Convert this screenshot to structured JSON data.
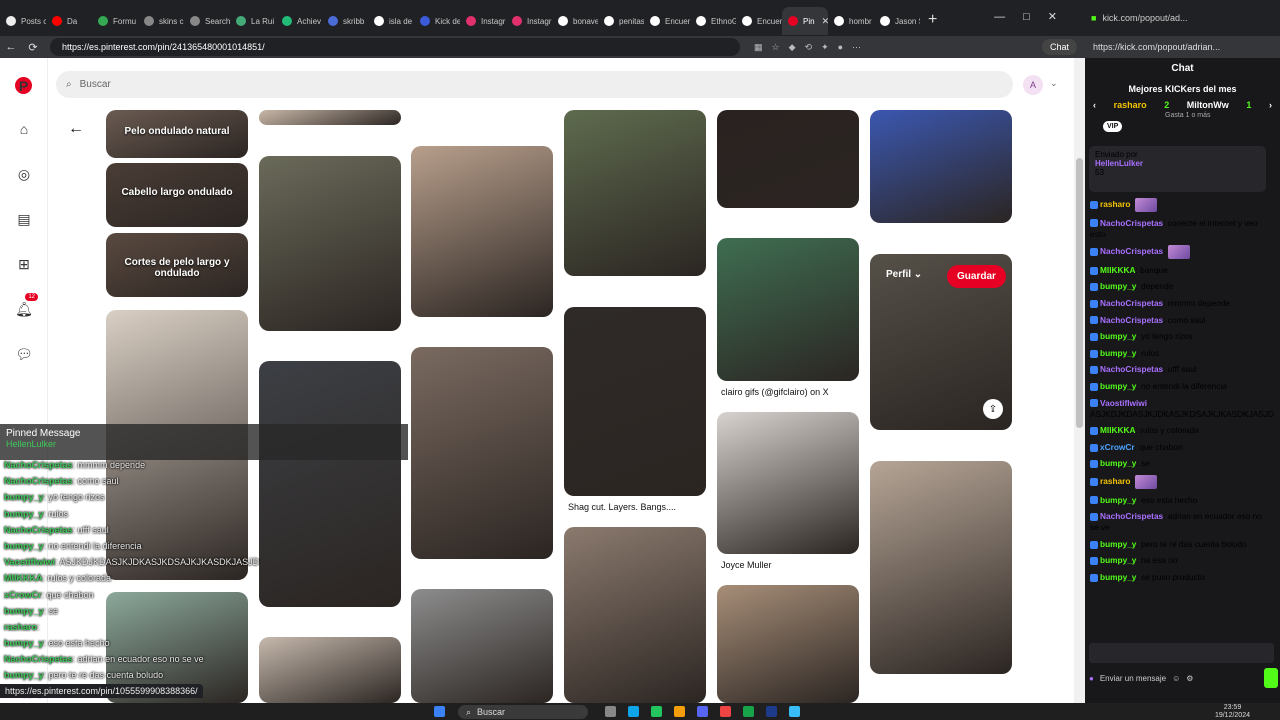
{
  "browser": {
    "tabs": [
      {
        "label": "Posts c",
        "color": "#eee"
      },
      {
        "label": "Da",
        "color": "#ff0000"
      },
      {
        "label": "Formu",
        "color": "#34a853"
      },
      {
        "label": "skins c",
        "color": "#888"
      },
      {
        "label": "Search",
        "color": "#888"
      },
      {
        "label": "La Rui",
        "color": "#4a7"
      },
      {
        "label": "Achiev",
        "color": "#2b7"
      },
      {
        "label": "skribb",
        "color": "#4b6bd8"
      },
      {
        "label": "isla de",
        "color": "#fff"
      },
      {
        "label": "Kick de",
        "color": "#3b5bdb"
      },
      {
        "label": "Instagr",
        "color": "#e1306c"
      },
      {
        "label": "Instagr",
        "color": "#e1306c"
      },
      {
        "label": "bonave",
        "color": "#fff"
      },
      {
        "label": "penitas",
        "color": "#fff"
      },
      {
        "label": "Encuen",
        "color": "#fff"
      },
      {
        "label": "EthnoG",
        "color": "#fff"
      },
      {
        "label": "Encuen",
        "color": "#fff"
      },
      {
        "label": "Pin",
        "color": "#e60023"
      },
      {
        "label": "hombr",
        "color": "#fff"
      },
      {
        "label": "Jason S",
        "color": "#fff"
      }
    ],
    "url": "https://es.pinterest.com/pin/241365480001014851/",
    "chat_button": "Chat",
    "status_url": "https://es.pinterest.com/pin/1055599908388366/"
  },
  "pinterest": {
    "search_placeholder": "Buscar",
    "avatar_letter": "A",
    "notification_count": "12",
    "boards": [
      "Pelo ondulado natural",
      "Cabello largo ondulado",
      "Cortes de pelo largo y ondulado"
    ],
    "captions": {
      "c1": "Shag cut. Layers. Bangs....",
      "c2": "clairo gifs (@gifclairo) on X",
      "c3": "Joyce Muller"
    },
    "perfil": "Perfil",
    "guardar": "Guardar"
  },
  "overlay": {
    "title": "Pinned Message",
    "pinned_user": "HellenLulker",
    "lines": [
      {
        "user": "NachoCrispetas",
        "text": "mmmm depende"
      },
      {
        "user": "NachoCrispetas",
        "text": "como saul"
      },
      {
        "user": "bumpy_y",
        "text": "yo tengo rizos"
      },
      {
        "user": "bumpy_y",
        "text": "rulos"
      },
      {
        "user": "NachoCrispetas",
        "text": "ufff saul"
      },
      {
        "user": "bumpy_y",
        "text": "no entendi la diferencia"
      },
      {
        "user": "Vaostiflwiwi",
        "text": "ASJKDJKDASJKJDKASJKDSAJKJKASDKJASJD"
      },
      {
        "user": "MIIKKKA",
        "text": "rulos y colorada"
      },
      {
        "user": "xCrowCr",
        "text": "que chabon"
      },
      {
        "user": "bumpy_y",
        "text": "se"
      },
      {
        "user": "rasharo",
        "text": ""
      },
      {
        "user": "bumpy_y",
        "text": "eso esta hecho"
      },
      {
        "user": "NachoCrispetas",
        "text": "adrian en ecuador eso no se ve"
      },
      {
        "user": "bumpy_y",
        "text": "pero te re das cuenta boludo"
      },
      {
        "user": "bumpy_y",
        "text": "na esa no"
      },
      {
        "user": "bumpy_y",
        "text": "se puso producto"
      }
    ]
  },
  "kick": {
    "tab_url_short": "kick.com/popout/ad...",
    "url": "https://kick.com/popout/adrian...",
    "chat_title": "Chat",
    "top_title": "Mejores KICKers del mes",
    "top1": "rasharo",
    "top1_count": "2",
    "top2": "MiltonWw",
    "top2_count": "1",
    "gasta": "Gasta 1",
    "o_mas": "o más",
    "vip": "VIP",
    "pinned_label": "Enviado por",
    "pinned_user": "HellenLulker",
    "pinned_text": "53",
    "messages": [
      {
        "user": "rasharo",
        "color": "#f3c400",
        "text": ""
      },
      {
        "user": "NachoCrispetas",
        "color": "#a970ff",
        "text": "conecte el internet y veo esto"
      },
      {
        "user": "NachoCrispetas",
        "color": "#a970ff",
        "text": ""
      },
      {
        "user": "MIIKKKA",
        "color": "#53fc18",
        "text": "banque"
      },
      {
        "user": "bumpy_y",
        "color": "#53fc18",
        "text": "depende"
      },
      {
        "user": "NachoCrispetas",
        "color": "#a970ff",
        "text": "mmmm depende"
      },
      {
        "user": "NachoCrispetas",
        "color": "#a970ff",
        "text": "como saul"
      },
      {
        "user": "bumpy_y",
        "color": "#53fc18",
        "text": "yo tengo rizos"
      },
      {
        "user": "bumpy_y",
        "color": "#53fc18",
        "text": "rulos"
      },
      {
        "user": "NachoCrispetas",
        "color": "#a970ff",
        "text": "ufff saul"
      },
      {
        "user": "bumpy_y",
        "color": "#53fc18",
        "text": "no entendi la diferencia"
      },
      {
        "user": "Vaostiflwiwi",
        "color": "#a970ff",
        "text": "ASJKDJKDASJKJDKASJKDSAJKJKASDKJASJD"
      },
      {
        "user": "MIIKKKA",
        "color": "#53fc18",
        "text": "rulos y colorada"
      },
      {
        "user": "xCrowCr",
        "color": "#4aa3ff",
        "text": "que chabon"
      },
      {
        "user": "bumpy_y",
        "color": "#53fc18",
        "text": "se"
      },
      {
        "user": "rasharo",
        "color": "#f3c400",
        "text": ""
      },
      {
        "user": "bumpy_y",
        "color": "#53fc18",
        "text": "eso esta hecho"
      },
      {
        "user": "NachoCrispetas",
        "color": "#a970ff",
        "text": "adrian en ecuador eso no se ve"
      },
      {
        "user": "bumpy_y",
        "color": "#53fc18",
        "text": "pero te re das cuenta boludo"
      },
      {
        "user": "bumpy_y",
        "color": "#53fc18",
        "text": "na esa no"
      },
      {
        "user": "bumpy_y",
        "color": "#53fc18",
        "text": "se puso producto"
      }
    ],
    "input_placeholder": "Enviar un mensaje"
  },
  "taskbar": {
    "search": "Buscar",
    "time": "23:59",
    "date": "19/12/2024"
  }
}
